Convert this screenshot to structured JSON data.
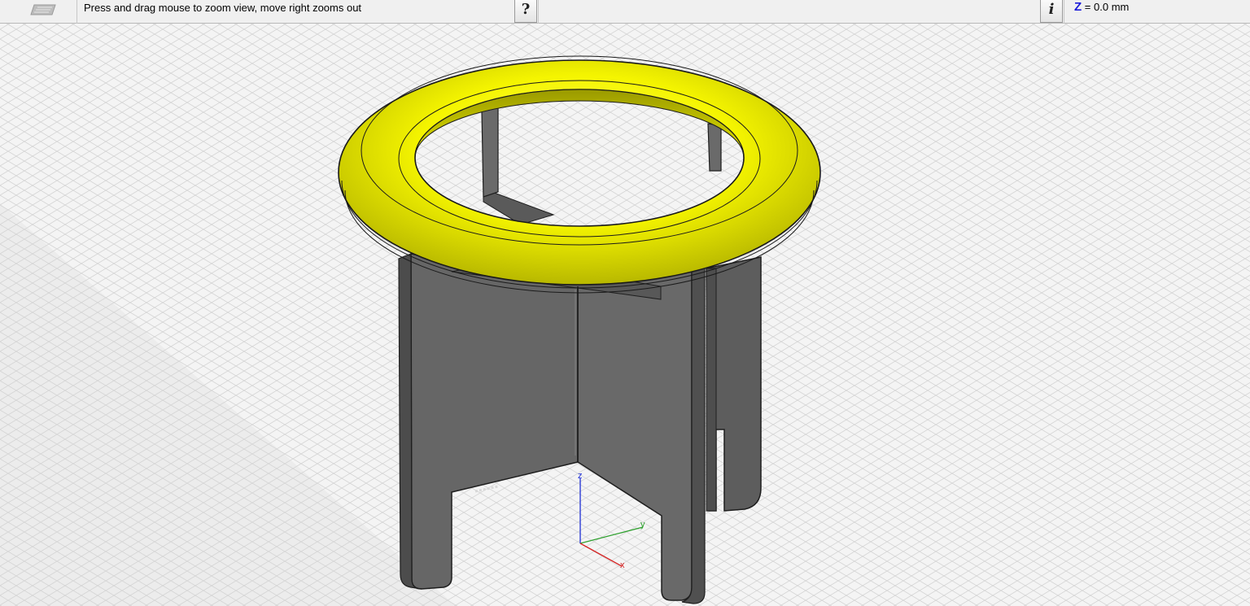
{
  "status_bar": {
    "prompt": "Press and drag mouse to zoom view, move right zooms out",
    "help_button": "?",
    "info_button": "i",
    "coordinate": {
      "axis": "Z",
      "equals": "=",
      "value": "0.0 mm"
    },
    "coordinate_axis_color": "#1c1cd9"
  },
  "viewport": {
    "model": {
      "ring_color": "#f5f500",
      "panel_color": "#636363",
      "floor_color": "#f4f4f4"
    },
    "triad": {
      "z_label": "z",
      "y_label": "y",
      "x_label": "x",
      "z_color": "#1e2fd6",
      "y_color": "#2fa02f",
      "x_color": "#d62424"
    }
  }
}
